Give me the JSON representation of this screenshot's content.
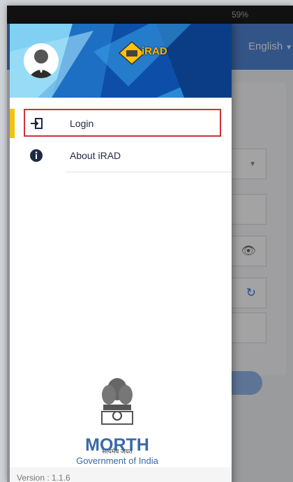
{
  "status_bar": {
    "battery": "59%"
  },
  "app_bar": {
    "language": "English"
  },
  "drawer": {
    "brand": "iRAD",
    "menu": [
      {
        "label": "Login",
        "icon": "login-icon",
        "active": true
      },
      {
        "label": "About iRAD",
        "icon": "info-icon",
        "active": false
      }
    ],
    "emblem_motto": "सत्यमेव जयते",
    "org_short": "MORTH",
    "org_full": "Government of India",
    "version": "Version : 1.1.6"
  },
  "colors": {
    "app_bar": "#4f82cf",
    "accent": "#f1c40f",
    "highlight": "#d0303a",
    "morth_blue": "#3a69a8"
  }
}
